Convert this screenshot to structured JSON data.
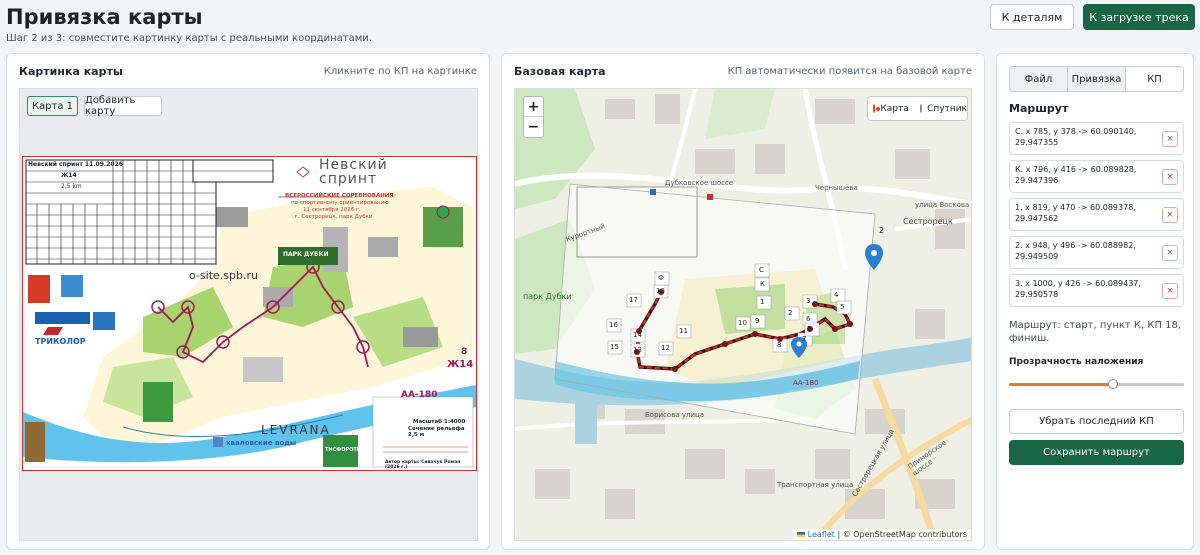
{
  "page": {
    "title": "Привязка карты",
    "subtitle": "Шаг 2 из 3: совместите картинку карты с реальными координатами.",
    "btn_details": "К деталям",
    "btn_next": "К загрузке трека"
  },
  "left_panel": {
    "title": "Картинка карты",
    "hint": "Кликните по КП на картинке",
    "chip_active": "Карта 1",
    "chip_add": "Добавить карту",
    "map_title_1": "Невский",
    "map_title_2": "спринт",
    "event_line": "ВСЕРОССИЙСКИЕ СОРЕВНОВАНИЯ",
    "event_sub": "по спортивному ориентированию",
    "event_date": "11 сентября 2026 г.",
    "event_place": "г. Сестрорецк, парк Дубки",
    "header_cell": "Невский спринт 11.09.2026",
    "group": "Ж14",
    "distance": "2,5 km",
    "course_code": "АА-180",
    "scale": "Масштаб 1:4000",
    "relief": "Сечение рельефа 2,5 м",
    "author": "Автор карты: Сивачук Роман (2026 г.)",
    "logo_osite": "o-site.spb.ru",
    "logo_tricolor": "ТРИКОЛОР",
    "logo_levrana": "LEVRANA",
    "logo_water": "хваловские воды",
    "logo_tis": "ТИСФОРОТІ",
    "logo_park": "ПАРК ДУБКИ",
    "group_big": "Ж14",
    "group_num": "8"
  },
  "center_panel": {
    "title": "Базовая карта",
    "hint": "КП автоматически появится на базовой карте",
    "zoom_in": "+",
    "zoom_out": "−",
    "layer_map": "Карта",
    "layer_sat": "Спутник",
    "attrib_leaflet": "Leaflet",
    "attrib_rest": "| © OpenStreetMap contributors",
    "street_1": "улица Воскова",
    "street_2": "Сестрорецк",
    "street_3": "Приморское шоссе",
    "street_4": "Чернышёва",
    "street_5": "Дубковское шоссе",
    "street_6": "парк Дубки",
    "street_7": "Курортный",
    "street_8": "Транспортная улица",
    "street_9": "Сестрорецкая улица",
    "street_10": "Борисова улица",
    "overlay_code": "АА-180"
  },
  "right_panel": {
    "tabs": [
      {
        "label": "Файл"
      },
      {
        "label": "Привязка"
      },
      {
        "label": "КП"
      }
    ],
    "route_title": "Маршрут",
    "route_items": [
      {
        "line1": "С. x 785, y 378 -> 60.090140,",
        "line2": "29.947355"
      },
      {
        "line1": "К. x 796, y 416 -> 60.089828,",
        "line2": "29.947396"
      },
      {
        "line1": "1. x 819, y 470 -> 60.089378,",
        "line2": "29.947562"
      },
      {
        "line1": "2. x 948, y 496 -> 60.088982,",
        "line2": "29.949509"
      },
      {
        "line1": "3. x 1000, y 426 -> 60.089437,",
        "line2": "29.950578"
      }
    ],
    "delete_symbol": "×",
    "route_summary": "Маршрут: старт, пункт К, КП 18, финиш.",
    "opacity_label": "Прозрачность наложения",
    "opacity_value": 0.6,
    "btn_remove": "Убрать последний КП",
    "btn_save": "Сохранить маршрут"
  },
  "colors": {
    "primary": "#19654a",
    "accent": "#e27a28",
    "danger": "#c23a3a",
    "map_red": "#c93030",
    "map_purple": "#9e1a55"
  }
}
